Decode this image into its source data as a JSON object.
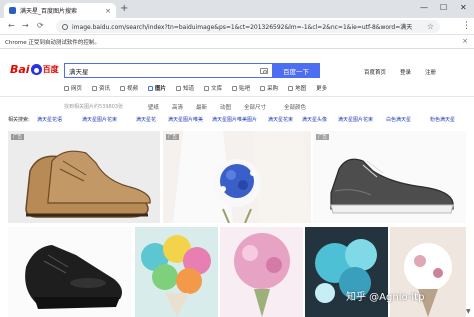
{
  "browser": {
    "tab_title": "满天星_百度图片搜索",
    "tab_close": "×",
    "new_tab": "+",
    "minimize": "—",
    "maximize": "☐",
    "close": "✕",
    "back": "←",
    "forward": "→",
    "reload": "⟳",
    "url": "image.baidu.com/search/index?tn=baiduimage&ps=1&ct=201326592&lm=-1&cl=2&nc=1&ie=utf-8&word=满天",
    "star": "☆",
    "menu": "⋮",
    "infobar_text": "Chrome 正受到自动测试软件的控制。",
    "infobar_close": "×"
  },
  "baidu": {
    "logo_text1": "Bai",
    "logo_text2": "百度",
    "search_value": "满天星",
    "search_button": "百度一下",
    "top_links": [
      "百度首页",
      "登录",
      "注册"
    ],
    "categories": [
      {
        "label": "网页",
        "active": false
      },
      {
        "label": "资讯",
        "active": false
      },
      {
        "label": "视频",
        "active": false
      },
      {
        "label": "图片",
        "active": true
      },
      {
        "label": "知道",
        "active": false
      },
      {
        "label": "文库",
        "active": false
      },
      {
        "label": "贴吧",
        "active": false
      },
      {
        "label": "采购",
        "active": false
      },
      {
        "label": "地图",
        "active": false
      },
      {
        "label": "更多",
        "active": false
      }
    ],
    "result_count": "找到相关图片约539803张",
    "filters": [
      "壁纸",
      "高清",
      "最新",
      "动图",
      "全部尺寸",
      "全部颜色"
    ],
    "related_label": "相关搜索:",
    "related": [
      "满天星花语",
      "满天星图片花束",
      "满天星花",
      "满天星图片唯美",
      "满天星图片唯美图片",
      "满天星花束",
      "满天星头像",
      "满天星图片花束",
      "满天星图片",
      "满天星图片高清唯美",
      "白色满天星",
      "粉色满天星"
    ]
  },
  "images": [
    {
      "name": "brown-boots-image",
      "ad": "广告"
    },
    {
      "name": "bride-bouquet-image",
      "ad": "广告"
    },
    {
      "name": "grey-sneaker-image",
      "ad": "广告"
    },
    {
      "name": "black-oxford-shoe-image",
      "ad": ""
    },
    {
      "name": "colorful-gypsophila-bouquet-image",
      "ad": ""
    },
    {
      "name": "pink-gypsophila-image",
      "ad": ""
    },
    {
      "name": "blue-gypsophila-image",
      "ad": ""
    },
    {
      "name": "white-gypsophila-bouquet-image",
      "ad": ""
    }
  ],
  "watermark": "知乎 @Agnio-ltp",
  "scroll_arrow": "▼",
  "colors": {
    "baidu_blue": "#4e6ef2",
    "baidu_red": "#e10601",
    "link_blue": "#2440b3"
  }
}
